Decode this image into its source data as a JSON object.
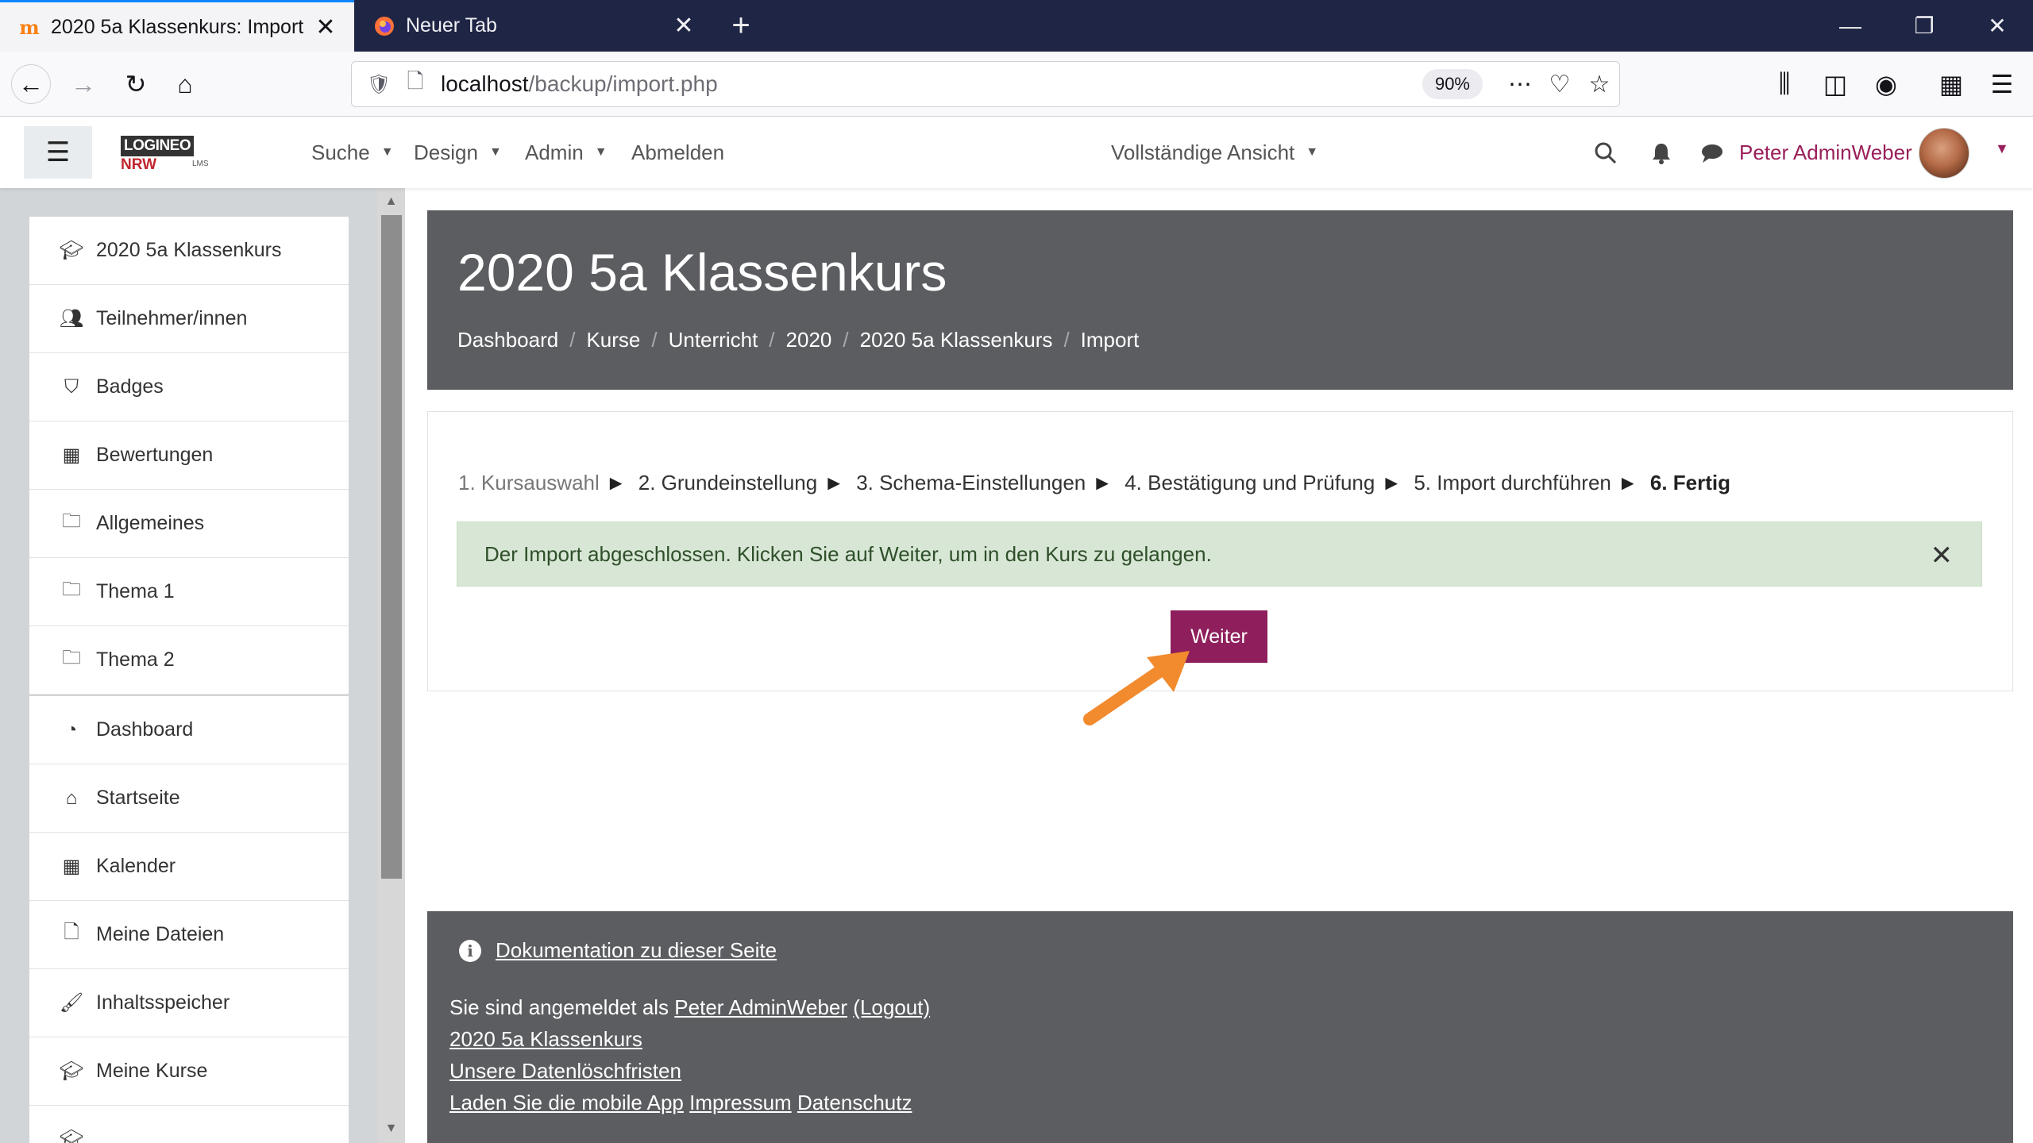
{
  "browser": {
    "tabs": [
      {
        "title": "2020 5a Klassenkurs: Import",
        "active": true
      },
      {
        "title": "Neuer Tab",
        "active": false
      }
    ],
    "new_tab_symbol": "+",
    "url_host": "localhost",
    "url_path": "/backup/import.php",
    "zoom": "90%"
  },
  "header": {
    "logo_part1": "LOGINEO",
    "logo_part2": "NRW",
    "logo_sub": "LMS",
    "menu": [
      {
        "label": "Suche"
      },
      {
        "label": "Design"
      },
      {
        "label": "Admin"
      },
      {
        "label": "Abmelden"
      }
    ],
    "view_mode": "Vollständige Ansicht",
    "username": "Peter AdminWeber"
  },
  "drawer": {
    "course_items": [
      {
        "label": "2020 5a Klassenkurs",
        "icon": "graduation-cap-icon"
      },
      {
        "label": "Teilnehmer/innen",
        "icon": "users-icon"
      },
      {
        "label": "Badges",
        "icon": "shield-icon"
      },
      {
        "label": "Bewertungen",
        "icon": "table-icon"
      },
      {
        "label": "Allgemeines",
        "icon": "folder-icon"
      },
      {
        "label": "Thema 1",
        "icon": "folder-icon"
      },
      {
        "label": "Thema 2",
        "icon": "folder-icon"
      }
    ],
    "site_items": [
      {
        "label": "Dashboard",
        "icon": "dashboard-icon"
      },
      {
        "label": "Startseite",
        "icon": "home-icon"
      },
      {
        "label": "Kalender",
        "icon": "calendar-icon"
      },
      {
        "label": "Meine Dateien",
        "icon": "file-icon"
      },
      {
        "label": "Inhaltsspeicher",
        "icon": "brush-icon"
      },
      {
        "label": "Meine Kurse",
        "icon": "graduation-cap-icon"
      }
    ]
  },
  "page": {
    "title": "2020 5a Klassenkurs",
    "breadcrumb": [
      "Dashboard",
      "Kurse",
      "Unterricht",
      "2020",
      "2020 5a Klassenkurs",
      "Import"
    ],
    "steps": [
      "1. Kursauswahl",
      "2. Grundeinstellung",
      "3. Schema-Einstellungen",
      "4. Bestätigung und Prüfung",
      "5. Import durchführen",
      "6. Fertig"
    ],
    "step_arrow": "►",
    "alert_text": "Der Import abgeschlossen. Klicken Sie auf Weiter, um in den Kurs zu gelangen.",
    "continue_label": "Weiter"
  },
  "footer": {
    "doc_link": "Dokumentation zu dieser Seite",
    "logged_in_prefix": "Sie sind angemeldet als",
    "logged_in_user": "Peter AdminWeber",
    "logout": "(Logout)",
    "course_link": "2020 5a Klassenkurs",
    "deletion_link": "Unsere Datenlöschfristen",
    "app_link": "Laden Sie die mobile App",
    "impressum": "Impressum",
    "privacy": "Datenschutz"
  },
  "colors": {
    "accent": "#8e1f5c",
    "header_bg": "#5c5d61",
    "success_bg": "#d8e7d5",
    "browser_tabbar": "#1f2544"
  }
}
